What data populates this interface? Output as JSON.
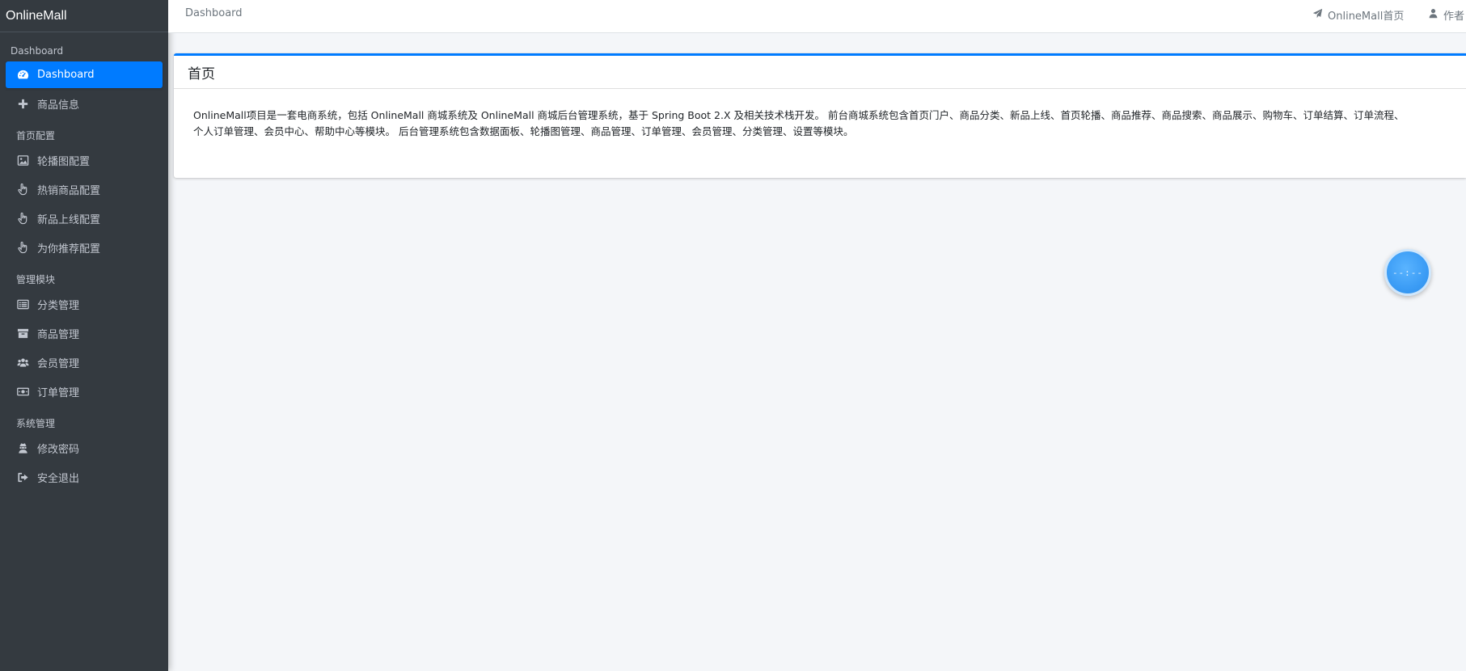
{
  "sidebar": {
    "brand": "OnlineMall",
    "sections": [
      {
        "header": "Dashboard",
        "items": [
          {
            "label": "Dashboard",
            "icon": "dashboard-icon",
            "active": true
          },
          {
            "label": "商品信息",
            "icon": "plus-icon",
            "active": false
          }
        ]
      },
      {
        "header": "首页配置",
        "items": [
          {
            "label": "轮播图配置",
            "icon": "image-icon",
            "active": false
          },
          {
            "label": "热销商品配置",
            "icon": "hand-pointer-icon",
            "active": false
          },
          {
            "label": "新品上线配置",
            "icon": "hand-pointer-icon",
            "active": false
          },
          {
            "label": "为你推荐配置",
            "icon": "hand-pointer-icon",
            "active": false
          }
        ]
      },
      {
        "header": "管理模块",
        "items": [
          {
            "label": "分类管理",
            "icon": "list-alt-icon",
            "active": false
          },
          {
            "label": "商品管理",
            "icon": "archive-icon",
            "active": false
          },
          {
            "label": "会员管理",
            "icon": "users-icon",
            "active": false
          },
          {
            "label": "订单管理",
            "icon": "money-bill-icon",
            "active": false
          }
        ]
      },
      {
        "header": "系统管理",
        "items": [
          {
            "label": "修改密码",
            "icon": "user-secret-icon",
            "active": false
          },
          {
            "label": "安全退出",
            "icon": "sign-out-icon",
            "active": false
          }
        ]
      }
    ]
  },
  "topbar": {
    "breadcrumb": "Dashboard",
    "home_link": "OnlineMall首页",
    "author_link": "作者"
  },
  "card": {
    "title": "首页",
    "body_line1": "OnlineMall项目是一套电商系统，包括 OnlineMall 商城系统及 OnlineMall 商城后台管理系统，基于 Spring Boot 2.X 及相关技术栈开发。 前台商城系统包含首页门户、商品分类、新品上线、首页轮播、商品推荐、商品搜索、商品展示、购物车、订单结算、订单流程、",
    "body_line2": "个人订单管理、会员中心、帮助中心等模块。 后台管理系统包含数据面板、轮播图管理、商品管理、订单管理、会员管理、分类管理、设置等模块。"
  },
  "floating_widget": {
    "text": "--:--"
  },
  "colors": {
    "sidebar_bg": "#343a40",
    "accent": "#007bff",
    "content_bg": "#f4f6f9"
  }
}
